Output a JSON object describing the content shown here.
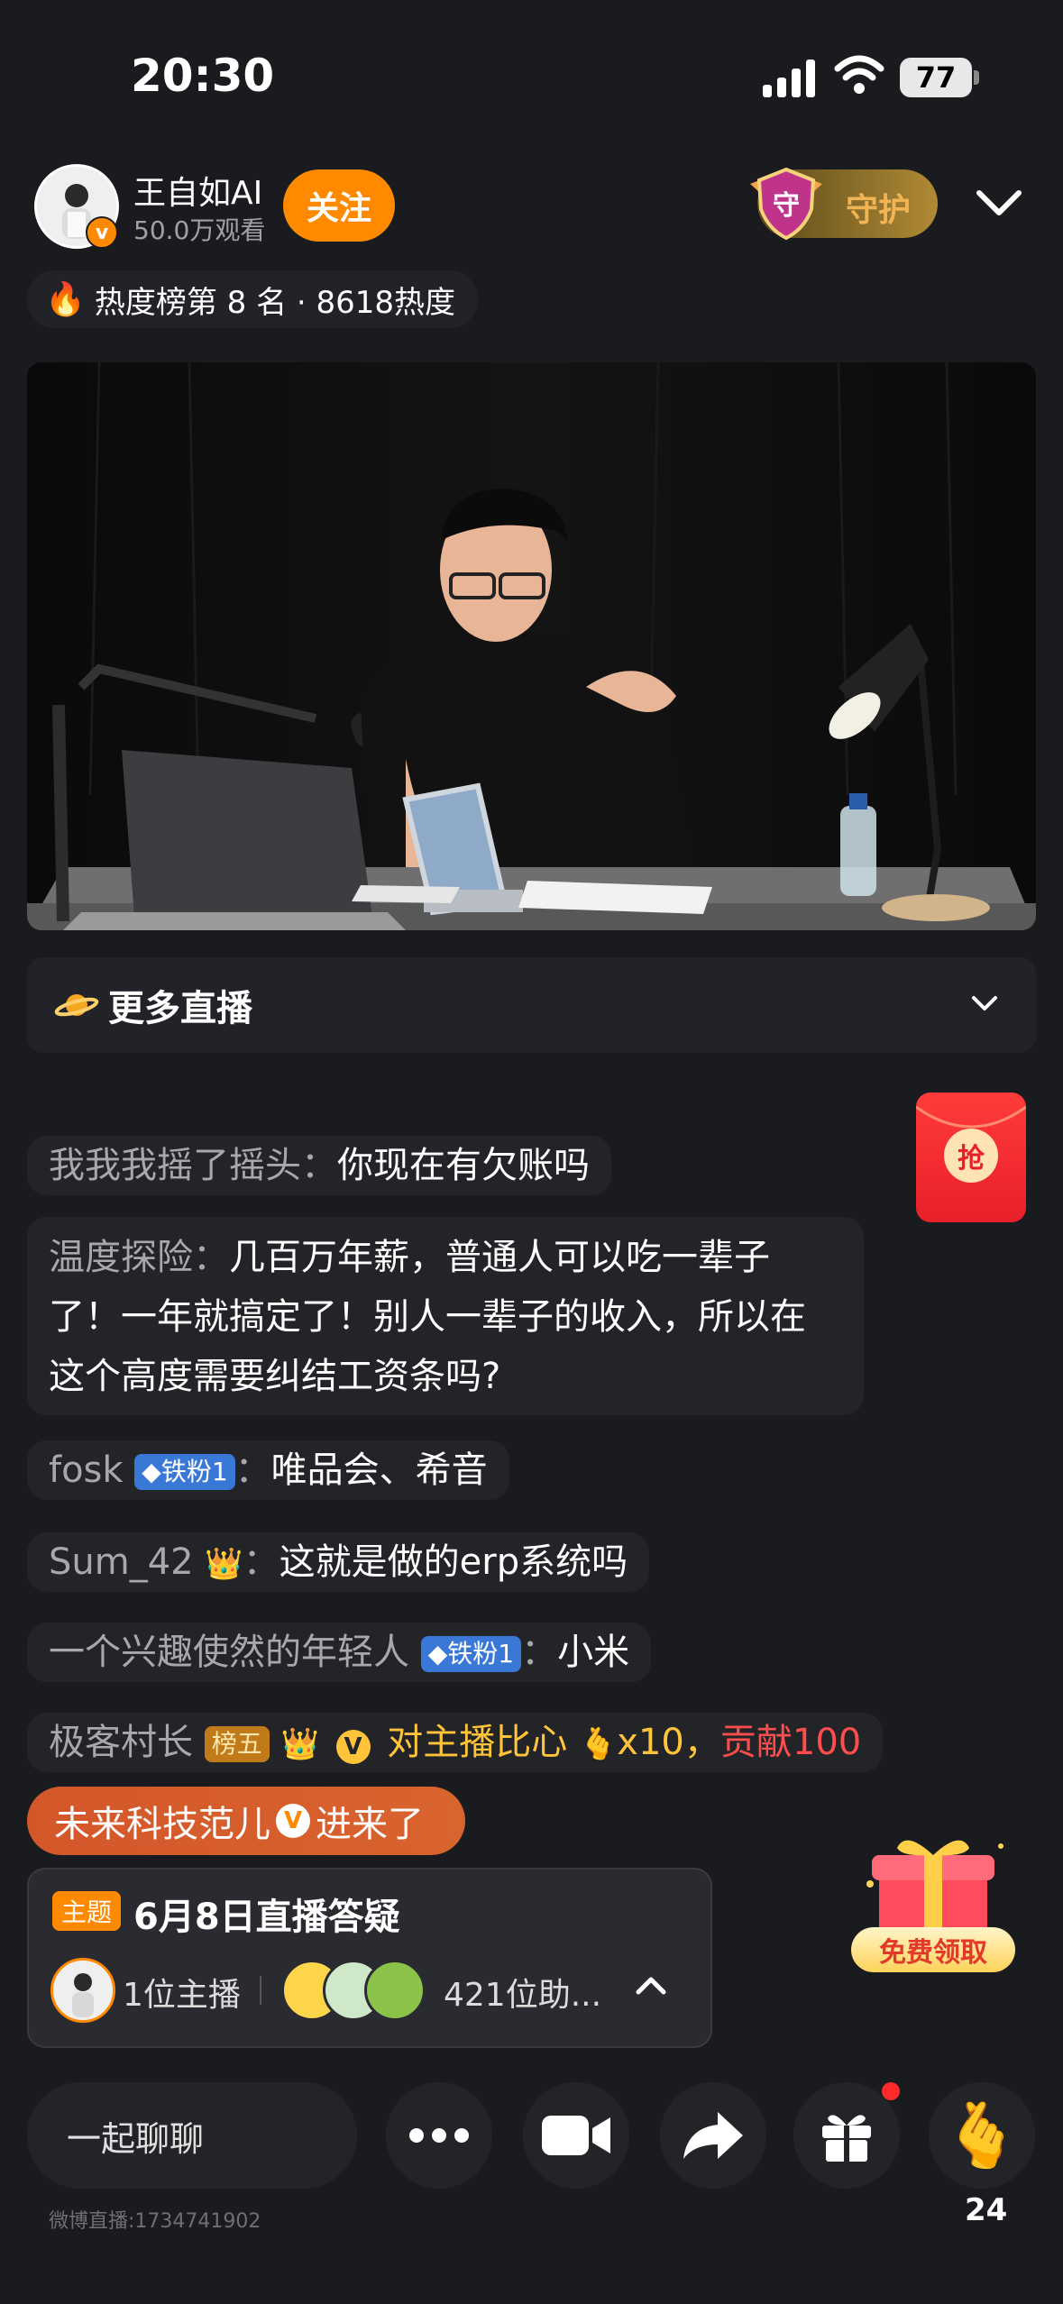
{
  "status_bar": {
    "time": "20:30",
    "battery": "77"
  },
  "header": {
    "streamer_name": "王自如AI",
    "viewers": "50.0万观看",
    "follow_label": "关注",
    "guard_label": "守护",
    "guard_badge_char": "守"
  },
  "hot_rank": {
    "text": "热度榜第 8 名 · 8618热度"
  },
  "more_live": {
    "label": "更多直播"
  },
  "red_packet": {
    "label": "抢"
  },
  "chat": [
    {
      "nick": "我我我摇了摇头",
      "sep": "：",
      "msg": "你现在有欠账吗"
    },
    {
      "nick": "温度探险",
      "sep": "：",
      "msg_lines": [
        "几百万年薪，普通人可以吃一辈子",
        "了！一年就搞定了！别人一辈子的收入，所以在",
        "这个高度需要纠结工资条吗?"
      ]
    },
    {
      "nick": "fosk",
      "badge": "铁粉1",
      "sep": "：",
      "msg": "唯品会、希音"
    },
    {
      "nick": "Sum_42",
      "sep": "：",
      "msg": "这就是做的erp系统吗"
    },
    {
      "nick": "一个兴趣使然的年轻人",
      "badge": "铁粉1",
      "sep": "：",
      "msg": "小米"
    },
    {
      "nick": "极客村长",
      "rank_badge": "榜五",
      "v": "V",
      "gift_text": "对主播比心",
      "gift_times": "x10，",
      "contrib": "贡献100"
    }
  ],
  "enter_notice": {
    "name": "未来科技范儿",
    "v": "V",
    "action": "进来了"
  },
  "topic": {
    "tag": "主题",
    "title": "6月8日直播答疑",
    "host_count": "1位主播",
    "assist_count": "421位助..."
  },
  "gift_promo": {
    "label": "免费领取"
  },
  "bottom_bar": {
    "chat_placeholder": "一起聊聊",
    "like_count": "24"
  },
  "room_id": "微博直播:1734741902",
  "colors": {
    "accent": "#ff8a00",
    "background": "#1a1b1f",
    "bubble": "#232428"
  }
}
